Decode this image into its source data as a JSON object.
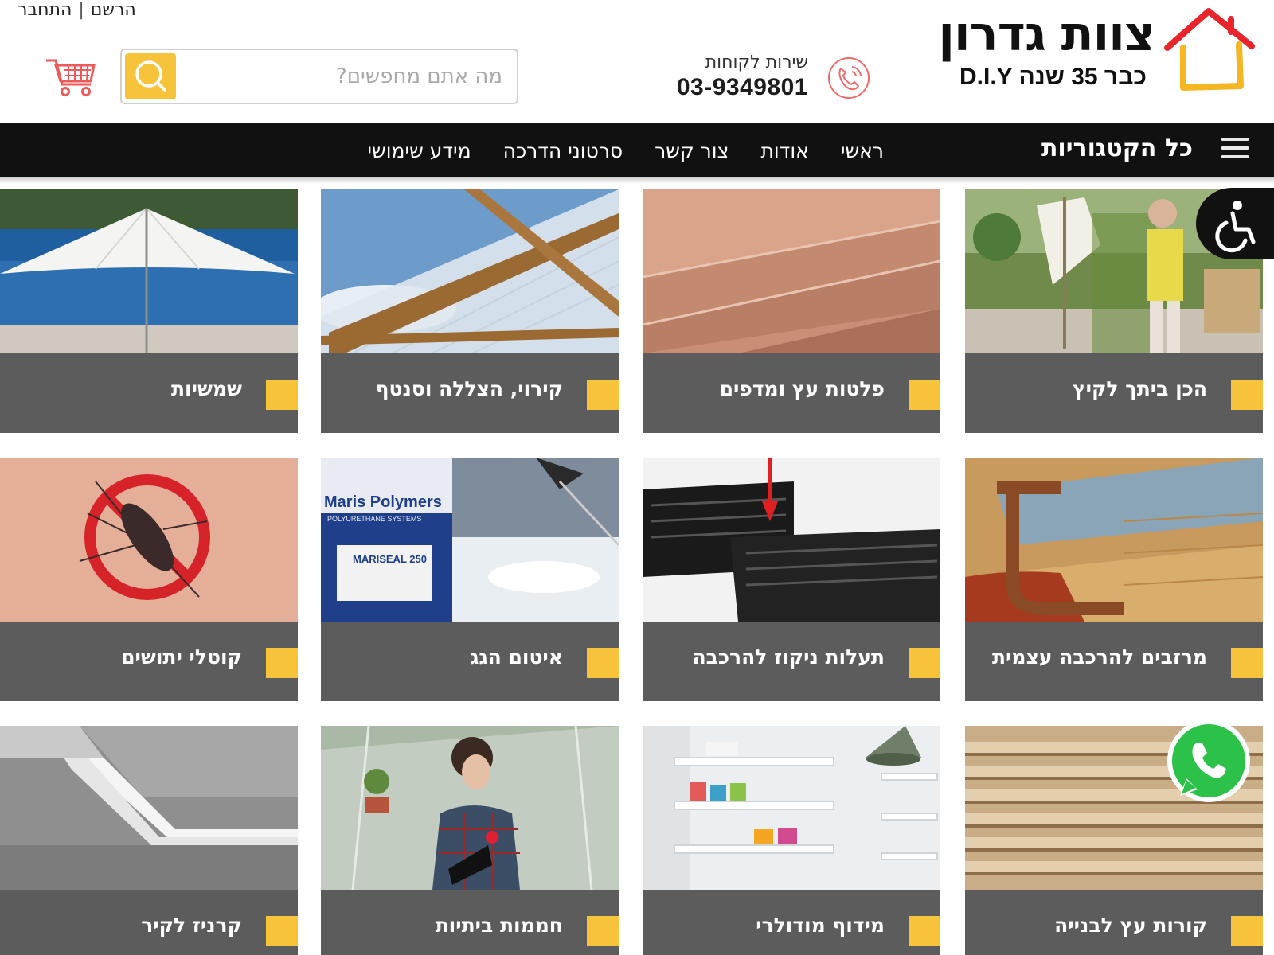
{
  "header": {
    "auth": {
      "register": "הרשם",
      "separator": "|",
      "login": "התחבר"
    },
    "search": {
      "placeholder": "מה אתם מחפשים?"
    },
    "service": {
      "label": "שירות לקוחות",
      "phone": "03-9349801"
    },
    "logo": {
      "title": "צוות גדרון",
      "subtitle": "D.I.Y כבר 35 שנה"
    }
  },
  "nav": {
    "all_categories": "כל הקטגוריות",
    "links": [
      "ראשי",
      "אודות",
      "צור קשר",
      "סרטוני הדרכה",
      "מידע שימושי"
    ]
  },
  "categories": [
    {
      "label": "הכן ביתך לקיץ"
    },
    {
      "label": "פלטות עץ ומדפים"
    },
    {
      "label": "קירוי, הצללה וסנטף"
    },
    {
      "label": "שמשיות"
    },
    {
      "label": "מרזבים להרכבה עצמית"
    },
    {
      "label": "תעלות ניקוז להרכבה"
    },
    {
      "label": "איטום הגג"
    },
    {
      "label": "קוטלי יתושים"
    },
    {
      "label": "קורות עץ לבנייה"
    },
    {
      "label": "מידוף מודולרי"
    },
    {
      "label": "חממות ביתיות"
    },
    {
      "label": "קרניז לקיר"
    }
  ],
  "images": {
    "roof_coating_brand": "Maris Polymers",
    "roof_coating_sub": "POLYURETHANE SYSTEMS",
    "roof_coating_product": "MARISEAL 250"
  },
  "colors": {
    "accent": "#f7c33a",
    "nav_bg": "#111111",
    "tile_bar": "#5c5c5c",
    "logo_red": "#e8252b"
  },
  "icons": [
    "cart-icon",
    "search-icon",
    "phone-icon",
    "hamburger-icon",
    "accessibility-icon",
    "whatsapp-icon"
  ]
}
